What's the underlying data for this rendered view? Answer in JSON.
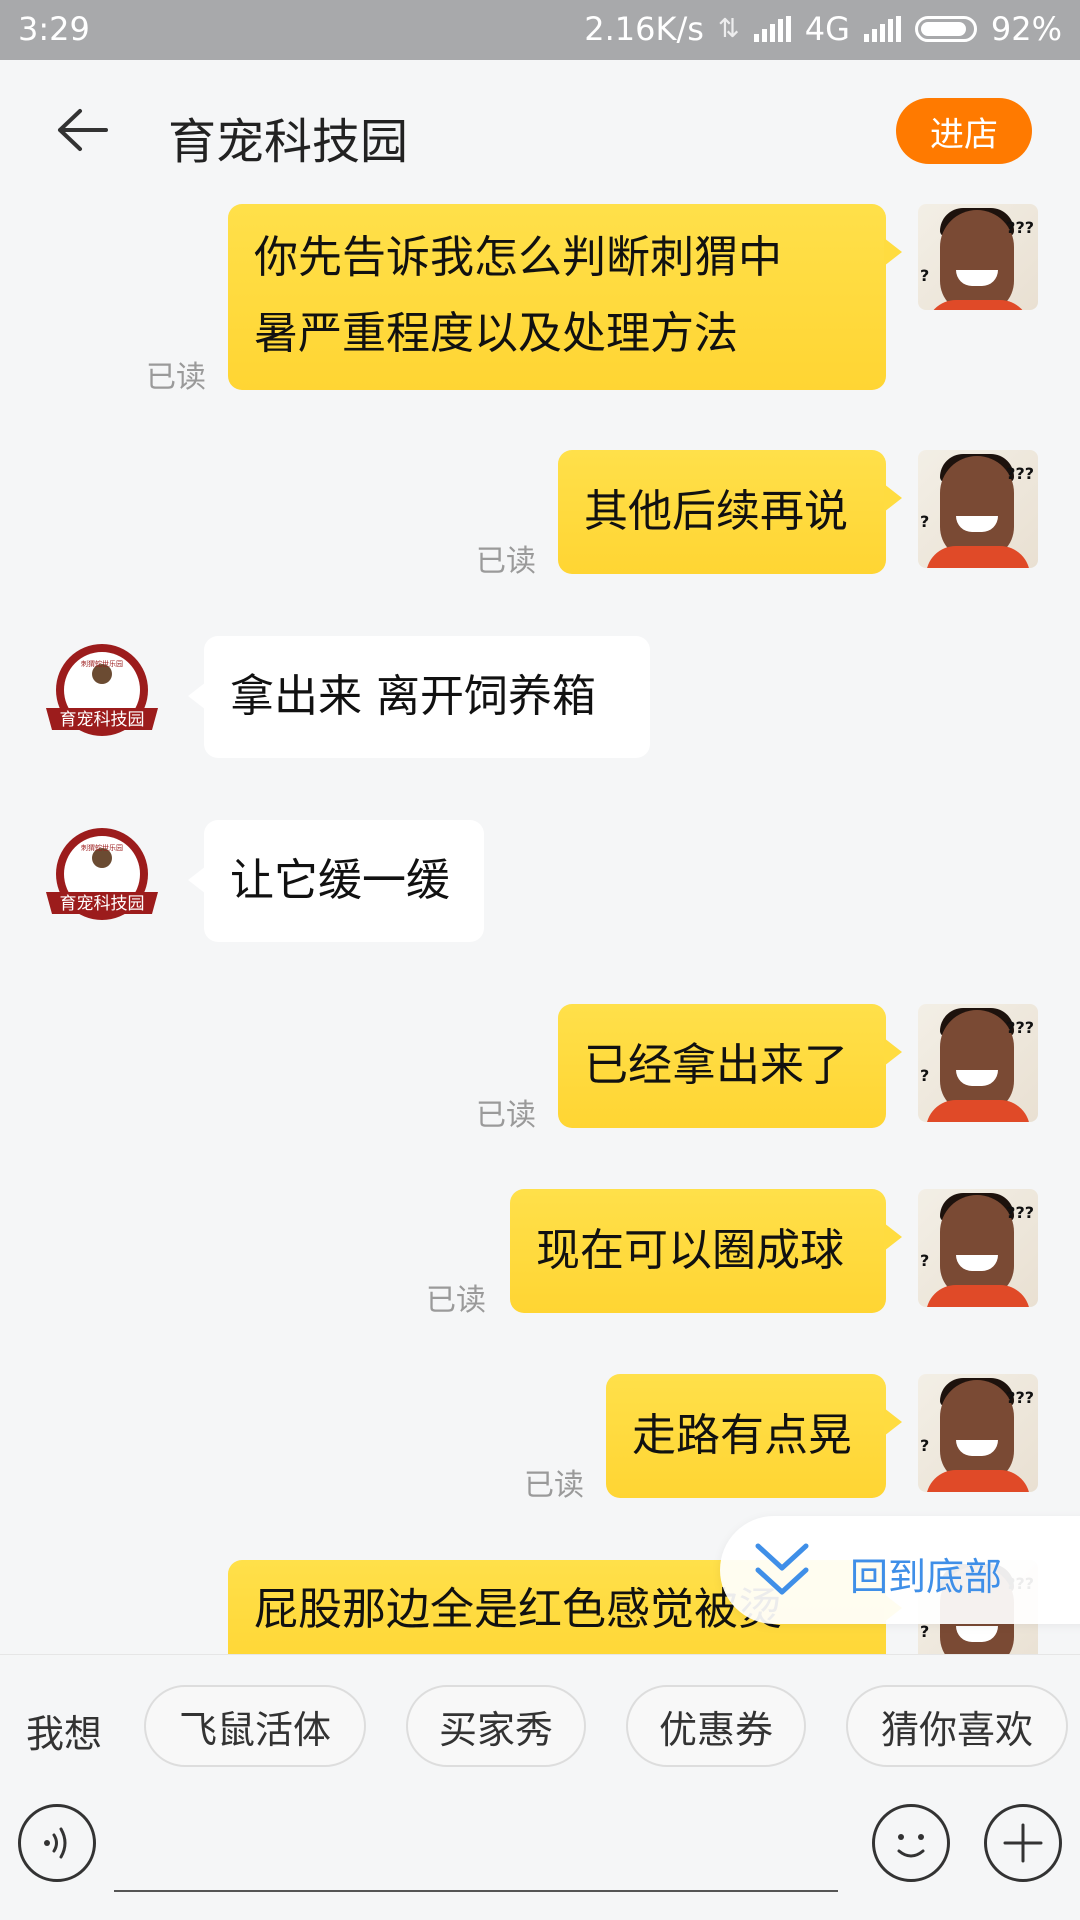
{
  "status": {
    "time": "3:29",
    "speed": "2.16K/s",
    "network": "4G",
    "battery": "92%"
  },
  "header": {
    "title": "育宠科技园",
    "enter_label": "进店"
  },
  "messages": [
    {
      "from": "me",
      "lines": [
        "你先告诉我怎么判断刺猬中",
        "暑严重程度以及处理方法"
      ],
      "read": "已读"
    },
    {
      "from": "me",
      "text": "其他后续再说",
      "read": "已读"
    },
    {
      "from": "shop",
      "text": "拿出来  离开饲养箱"
    },
    {
      "from": "shop",
      "text": "让它缓一缓"
    },
    {
      "from": "me",
      "text": "已经拿出来了",
      "read": "已读"
    },
    {
      "from": "me",
      "text": "现在可以圈成球",
      "read": "已读"
    },
    {
      "from": "me",
      "text": "走路有点晃",
      "read": "已读"
    },
    {
      "from": "me",
      "text": "屁股那边全是红色感觉被烫"
    }
  ],
  "avatar": {
    "me_marks": [
      "???",
      "?"
    ],
    "shop_badge_text": "育宠科技园",
    "shop_seal_text": "刺猬蛇世乐园"
  },
  "to_bottom_label": "回到底部",
  "quick": {
    "label": "我想",
    "chips": [
      "飞鼠活体",
      "买家秀",
      "优惠券",
      "猜你喜欢"
    ]
  },
  "input": {
    "placeholder": ""
  },
  "colors": {
    "accent": "#ff7a00",
    "my_bubble": "#ffd533",
    "link": "#3f8fe8"
  }
}
